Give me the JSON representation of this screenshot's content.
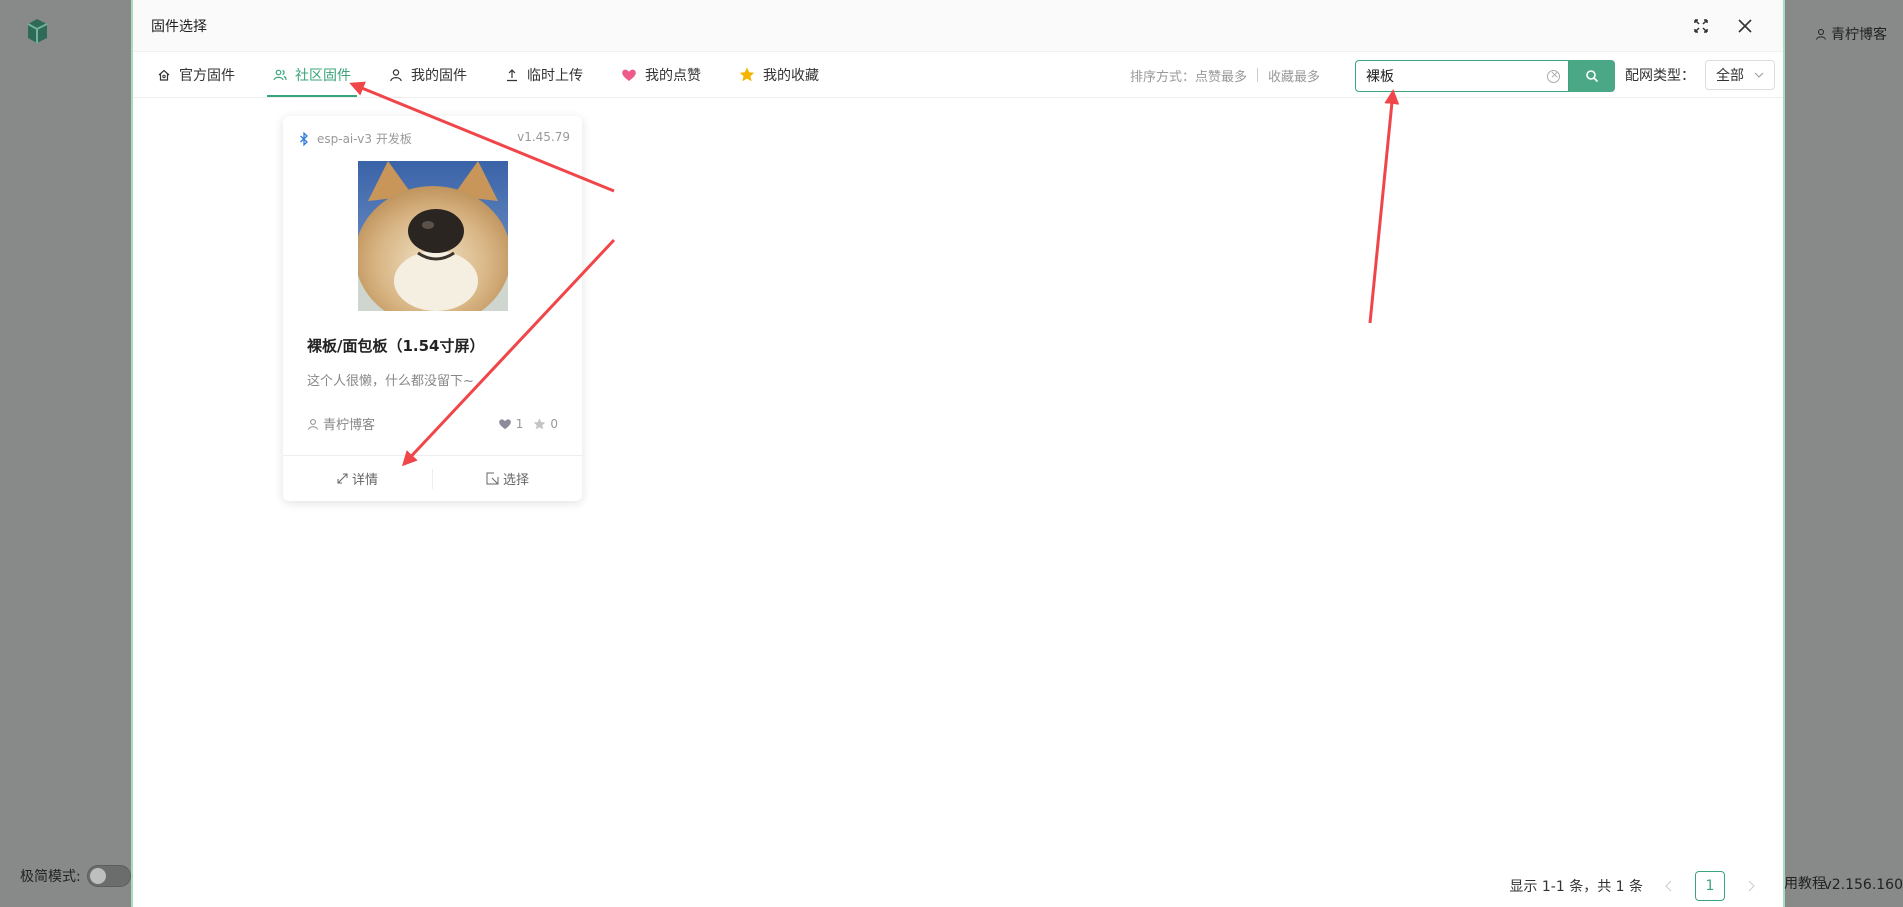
{
  "background": {
    "user": "青柠博客",
    "simple_mode_label": "极简模式:",
    "tutorial": "用教程",
    "version": "v2.156.160"
  },
  "modal": {
    "title": "固件选择",
    "tabs": [
      {
        "label": "官方固件",
        "icon": "home-icon",
        "active": false
      },
      {
        "label": "社区固件",
        "icon": "community-icon",
        "active": true
      },
      {
        "label": "我的固件",
        "icon": "user-icon",
        "active": false
      },
      {
        "label": "临时上传",
        "icon": "upload-icon",
        "active": false
      },
      {
        "label": "我的点赞",
        "icon": "heart-icon",
        "active": false
      },
      {
        "label": "我的收藏",
        "icon": "star-icon",
        "active": false
      }
    ],
    "sort": {
      "label": "排序方式：",
      "options": [
        "点赞最多",
        "收藏最多"
      ]
    },
    "search": {
      "value": "裸板"
    },
    "network": {
      "label": "配网类型：",
      "value": "全部"
    },
    "card": {
      "board": "esp-ai-v3 开发板",
      "version": "v1.45.79",
      "title": "裸板/面包板（1.54寸屏）",
      "description": "这个人很懒，什么都没留下~",
      "author": "青柠博客",
      "likes": "1",
      "favorites": "0",
      "detail_label": "详情",
      "select_label": "选择"
    },
    "pagination": {
      "summary": "显示 1-1 条，共 1 条",
      "current_page": "1"
    }
  },
  "colors": {
    "accent": "#3ca47a",
    "arrow": "#f0464a"
  }
}
